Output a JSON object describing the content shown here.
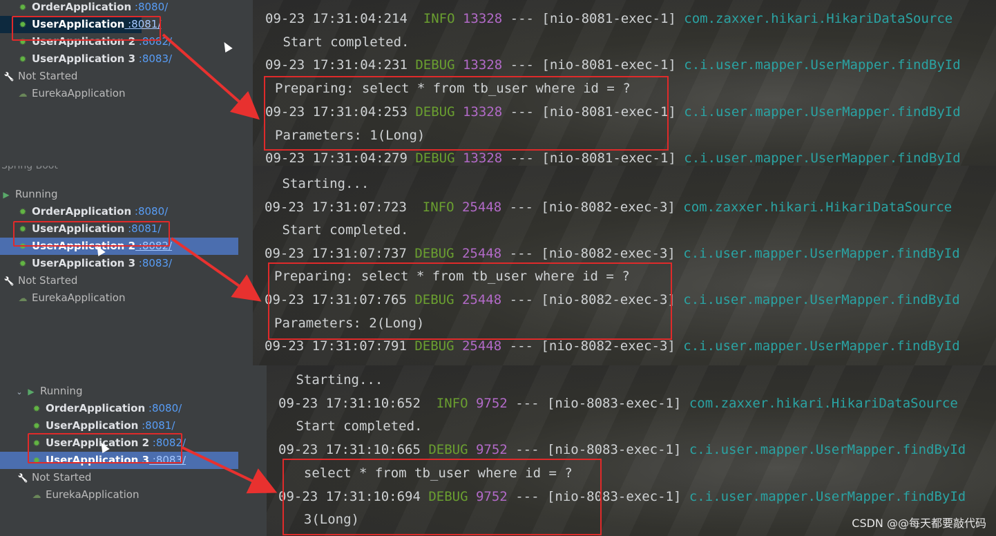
{
  "panels": [
    {
      "tree": [
        {
          "kind": "app",
          "name": "OrderApplication",
          "port": ":8080/"
        },
        {
          "kind": "app",
          "name": "UserApplication",
          "port": ":8081/",
          "selected": true
        },
        {
          "kind": "app",
          "name": "UserApplication 2",
          "port": ":8082/"
        },
        {
          "kind": "app",
          "name": "UserApplication 3",
          "port": ":8083/"
        },
        {
          "kind": "group",
          "name": "Not Started"
        },
        {
          "kind": "plain",
          "name": "EurekaApplication"
        }
      ],
      "logs": [
        {
          "ts": "09-23 17:31:04:214",
          "level": " INFO",
          "pid": "13328",
          "sep": "---",
          "thread": "[nio-8081-exec-1]",
          "logger": "com.zaxxer.hikari.HikariDataSource"
        },
        {
          "msg": " Start completed."
        },
        {
          "ts": "09-23 17:31:04:231",
          "level": "DEBUG",
          "pid": "13328",
          "sep": "---",
          "thread": "[nio-8081-exec-1]",
          "logger": "c.i.user.mapper.UserMapper.findById"
        },
        {
          "msg": "Preparing: select * from tb_user where id = ?"
        },
        {
          "ts": "09-23 17:31:04:253",
          "level": "DEBUG",
          "pid": "13328",
          "sep": "---",
          "thread": "[nio-8081-exec-1]",
          "logger": "c.i.user.mapper.UserMapper.findById"
        },
        {
          "msg": "Parameters: 1(Long)"
        },
        {
          "ts": "09-23 17:31:04:279",
          "level": "DEBUG",
          "pid": "13328",
          "sep": "---",
          "thread": "[nio-8081-exec-1]",
          "logger": "c.i.user.mapper.UserMapper.findById"
        }
      ]
    },
    {
      "header": "Spring Boot",
      "running": "Running",
      "tree": [
        {
          "kind": "app",
          "name": "OrderApplication",
          "port": ":8080/"
        },
        {
          "kind": "app",
          "name": "UserApplication",
          "port": ":8081/"
        },
        {
          "kind": "app",
          "name": "UserApplication 2",
          "port": ":8082/",
          "selected": true
        },
        {
          "kind": "app",
          "name": "UserApplication 3",
          "port": ":8083/"
        },
        {
          "kind": "group",
          "name": "Not Started"
        },
        {
          "kind": "plain",
          "name": "EurekaApplication"
        }
      ],
      "logs": [
        {
          "msg": " Starting..."
        },
        {
          "ts": "09-23 17:31:07:723",
          "level": " INFO",
          "pid": "25448",
          "sep": "---",
          "thread": "[nio-8082-exec-3]",
          "logger": "com.zaxxer.hikari.HikariDataSource"
        },
        {
          "msg": " Start completed."
        },
        {
          "ts": "09-23 17:31:07:737",
          "level": "DEBUG",
          "pid": "25448",
          "sep": "---",
          "thread": "[nio-8082-exec-3]",
          "logger": "c.i.user.mapper.UserMapper.findById"
        },
        {
          "msg": "Preparing: select * from tb_user where id = ?"
        },
        {
          "ts": "09-23 17:31:07:765",
          "level": "DEBUG",
          "pid": "25448",
          "sep": "---",
          "thread": "[nio-8082-exec-3]",
          "logger": "c.i.user.mapper.UserMapper.findById"
        },
        {
          "msg": "Parameters: 2(Long)"
        },
        {
          "ts": "09-23 17:31:07:791",
          "level": "DEBUG",
          "pid": "25448",
          "sep": "---",
          "thread": "[nio-8082-exec-3]",
          "logger": "c.i.user.mapper.UserMapper.findById"
        }
      ]
    },
    {
      "running": "Running",
      "tree": [
        {
          "kind": "app",
          "name": "OrderApplication",
          "port": ":8080/"
        },
        {
          "kind": "app",
          "name": "UserApplication",
          "port": ":8081/"
        },
        {
          "kind": "app",
          "name": "UserApplication 2",
          "port": ":8082/"
        },
        {
          "kind": "app",
          "name": "UserApplication 3",
          "port": ":8083/",
          "selected": true
        },
        {
          "kind": "group",
          "name": "Not Started"
        },
        {
          "kind": "plain",
          "name": "EurekaApplication"
        }
      ],
      "logs": [
        {
          "msg": " Starting..."
        },
        {
          "ts": "09-23 17:31:10:652",
          "level": " INFO",
          "pid": "9752",
          "sep": "---",
          "thread": "[nio-8083-exec-1]",
          "logger": "com.zaxxer.hikari.HikariDataSource"
        },
        {
          "msg": " Start completed."
        },
        {
          "ts": "09-23 17:31:10:665",
          "level": "DEBUG",
          "pid": "9752",
          "sep": "---",
          "thread": "[nio-8083-exec-1]",
          "logger": "c.i.user.mapper.UserMapper.findById"
        },
        {
          "msg": "  select * from tb_user where id = ?"
        },
        {
          "ts": "09-23 17:31:10:694",
          "level": "DEBUG",
          "pid": "9752",
          "sep": "---",
          "thread": "[nio-8083-exec-1]",
          "logger": "c.i.user.mapper.UserMapper.findById"
        },
        {
          "msg": "  3(Long)"
        }
      ]
    }
  ],
  "watermark": "CSDN @@每天都要敲代码",
  "colors": {
    "highlight": "#e02a2a",
    "selected_row": "#4b6eaf",
    "info": "#6a9f30",
    "pid": "#b26ac8",
    "logger": "#2aa3a3"
  },
  "icons": {
    "app": "bug-icon",
    "group": "wrench-icon",
    "running": "run-icon",
    "expand": "chevron-down-icon",
    "plain": "eureka-icon"
  }
}
